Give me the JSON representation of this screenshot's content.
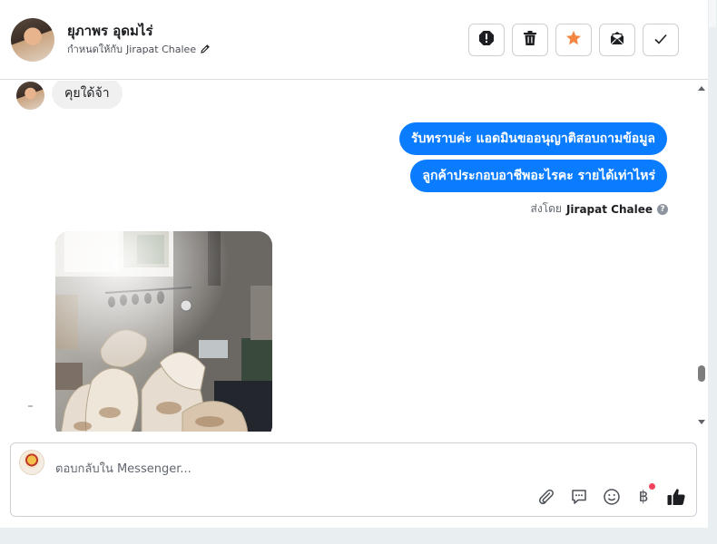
{
  "header": {
    "contact_name": "ยุภาพร อุดมไร่",
    "assigned_to_prefix": "กำหนดให้กับ",
    "assigned_to_name": "Jirapat Chalee"
  },
  "messages": {
    "incoming_text": "คุยใด้จ้า",
    "outgoing": [
      "รับทราบค่ะ แอดมินขออนุญาติสอบถามข้อมูล",
      "ลูกค้าประกอบอาชีพอะไรคะ รายได้เท่าไหร่"
    ],
    "sent_by_prefix": "ส่งโดย",
    "sent_by_name": "Jirapat Chalee"
  },
  "composer": {
    "placeholder": "ตอบกลับใน Messenger...",
    "currency_symbol": "฿"
  },
  "colors": {
    "outgoing_bubble": "#0a7cff",
    "star": "#f5853f",
    "notification_dot": "#f3425f"
  },
  "icons": [
    "alert-icon",
    "trash-icon",
    "star-icon",
    "mark-unread-icon",
    "check-icon",
    "pencil-icon",
    "help-icon",
    "attachment-icon",
    "saved-replies-icon",
    "emoji-icon",
    "payment-icon",
    "thumbs-up-icon"
  ]
}
